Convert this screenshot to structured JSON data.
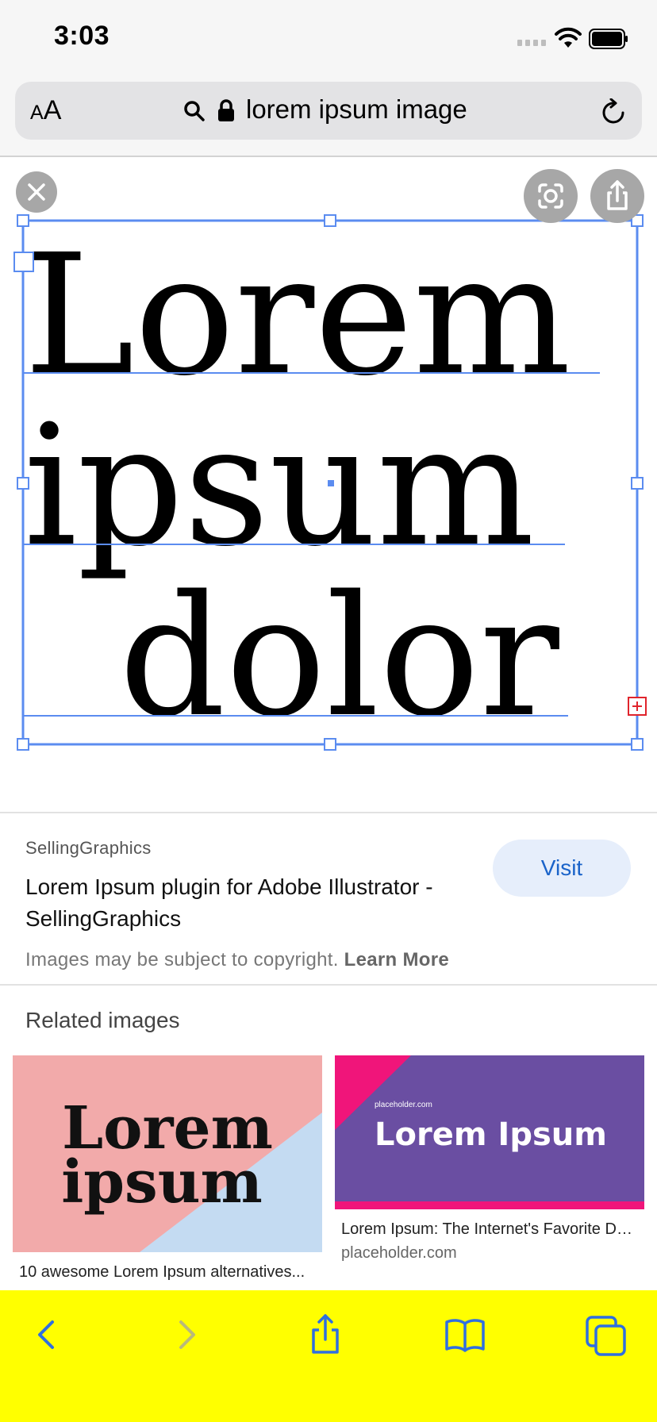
{
  "status_bar": {
    "time": "3:03"
  },
  "address_bar": {
    "text_size_label_small": "A",
    "text_size_label_large": "A",
    "url_text": "lorem ipsum image"
  },
  "image_viewer": {
    "image_lines": [
      "Lorem",
      "ipsum",
      "dolor"
    ]
  },
  "result": {
    "source": "SellingGraphics",
    "title": "Lorem Ipsum plugin for Adobe Illustrator - SellingGraphics",
    "visit_label": "Visit",
    "copyright_text": "Images may be subject to copyright.",
    "learn_more_label": "Learn More"
  },
  "related": {
    "heading": "Related images",
    "cards": [
      {
        "image_text_line1": "Lorem",
        "image_text_line2": "ipsum",
        "caption": "10 awesome Lorem Ipsum alternatives..."
      },
      {
        "image_small_text": "placeholder.com",
        "image_text": "Lorem Ipsum",
        "caption": "Lorem Ipsum: The Internet's Favorite Dummy Text",
        "source": "placeholder.com"
      }
    ]
  },
  "colors": {
    "toolbar_bg": "#ffff00",
    "accent_blue": "#1a63c9",
    "selection_blue": "#5b8cf0",
    "card1_pink": "#f2aaaa",
    "card1_blue": "#c4dbf2",
    "card2_purple": "#6a4ea2",
    "card2_magenta": "#f0157a"
  },
  "toolbar": {
    "icons": [
      "back-icon",
      "forward-icon",
      "share-icon",
      "bookmarks-icon",
      "tabs-icon"
    ]
  }
}
